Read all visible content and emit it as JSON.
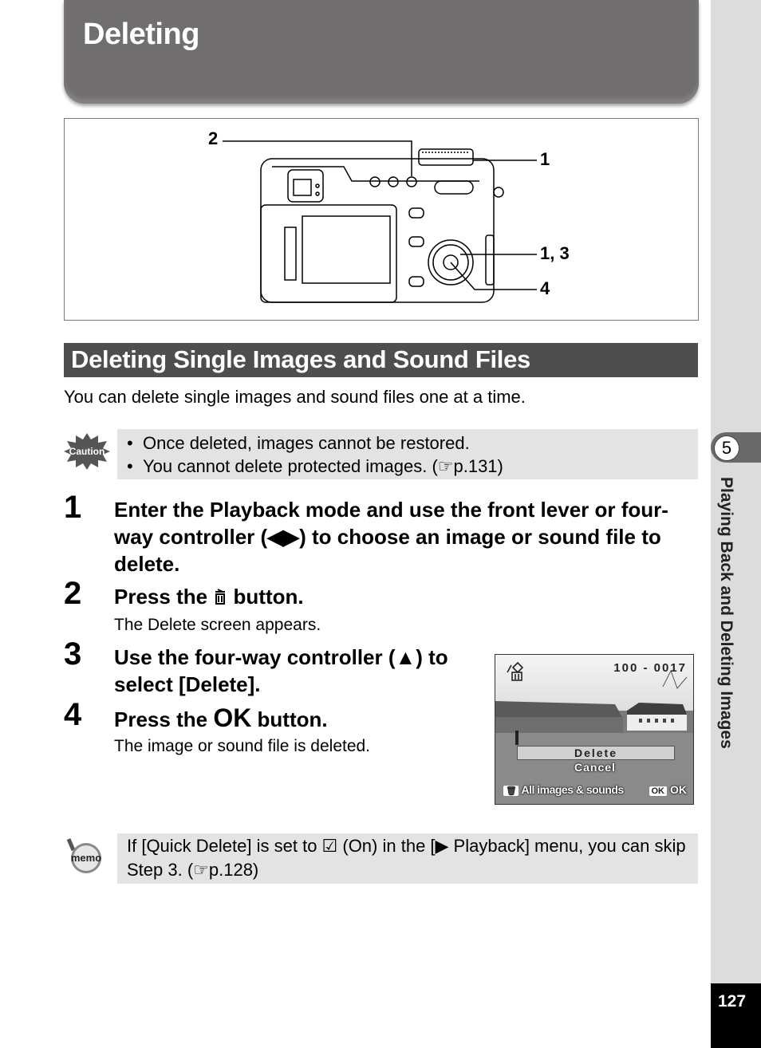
{
  "page": {
    "title": "Deleting",
    "section_title": "Deleting Single Images and Sound Files",
    "intro": "You can delete single images and sound files one at a time.",
    "page_number": "127"
  },
  "figure": {
    "callouts": [
      "2",
      "1",
      "1, 3",
      "4"
    ]
  },
  "caution": {
    "badge": "Caution",
    "items": [
      "Once deleted, images cannot be restored.",
      "You cannot delete protected images. (☞p.131)"
    ]
  },
  "steps": [
    {
      "num": "1",
      "text": "Enter the Playback mode and use the front lever or four-way controller (◀▶) to choose an image or sound file to delete.",
      "sub": ""
    },
    {
      "num": "2",
      "text_before": "Press the",
      "icon": "trash-icon",
      "text_after": "button.",
      "sub": "The Delete screen appears."
    },
    {
      "num": "3",
      "text": "Use the four-way controller (▲) to select [Delete].",
      "sub": ""
    },
    {
      "num": "4",
      "text_before": "Press the",
      "icon_text": "OK",
      "text_after": "button.",
      "sub": "The image or sound file is deleted."
    }
  ],
  "lcd": {
    "file_number": "100 - 0017",
    "menu_selected": "Delete",
    "menu_other": "Cancel",
    "bottom_left": "All images & sounds",
    "bottom_right_chip": "OK",
    "bottom_right": "OK"
  },
  "memo": {
    "badge": "memo",
    "text": "If [Quick Delete] is set to ☑ (On) in the [▶ Playback] menu, you can skip Step 3. (☞p.128)"
  },
  "sidebar": {
    "chapter_number": "5",
    "chapter_title": "Playing Back and Deleting Images"
  }
}
